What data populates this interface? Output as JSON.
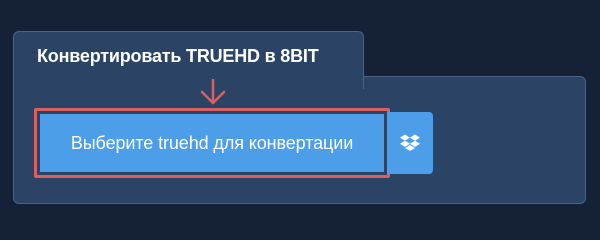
{
  "converter": {
    "title": "Конвертировать TRUEHD в 8BIT",
    "upload_label": "Выберите truehd для конвертации",
    "dropbox_icon": "dropbox-icon",
    "arrow_icon": "arrow-down-icon"
  },
  "colors": {
    "page_background": "#142137",
    "panel_background": "#2b4466",
    "button_blue": "#4c9ee9",
    "highlight_red": "#d95f60"
  }
}
